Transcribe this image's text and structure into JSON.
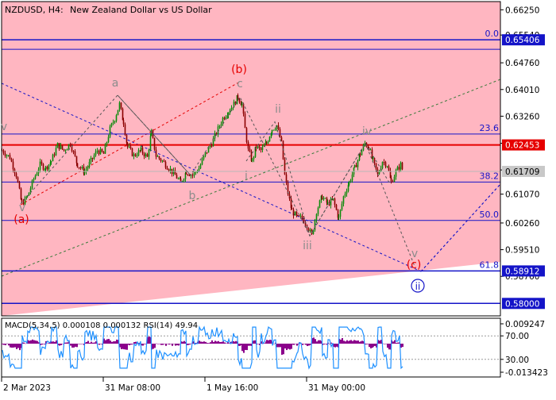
{
  "header": {
    "symbol": "NZDUSD, H4:",
    "description": "New Zealand Dollar vs US Dollar"
  },
  "colors": {
    "background_upper": "#ffb6c1",
    "background_lower": "#ffffff",
    "frame": "#000000",
    "fib_line": "#1414c8",
    "resistance_line": "#e60000",
    "price_label_bg": "#e60000",
    "support_label_bg": "#1414c8",
    "current_label_bg": "#c8c8c8",
    "candle_up": "#0a8a0a",
    "candle_down": "#8a0000",
    "wave_main": "#e60000",
    "wave_minor": "#8c8c8c",
    "wave_circle": "#1414c8",
    "channel_dotted": "#1414c8",
    "trend_dotted": "#3a7a3a",
    "macd_hist": "#8b008b",
    "rsi_line": "#1e90ff"
  },
  "price_axis": {
    "ticks": [
      "0.66250",
      "0.65540",
      "0.64760",
      "0.64010",
      "0.63260",
      "0.62500",
      "0.61750",
      "0.61070",
      "0.60260",
      "0.59510",
      "0.58760"
    ]
  },
  "price_labels": {
    "fib_0": "0.65406",
    "resistance": "0.62453",
    "current": "0.61709",
    "fib_61_8": "0.58912",
    "support": "0.58000"
  },
  "fib_levels": [
    "0.0",
    "23.6",
    "38.2",
    "50.0",
    "61.8"
  ],
  "wave_labels": {
    "main": [
      "(a)",
      "(b)",
      "(c)"
    ],
    "minor": [
      "a",
      "b",
      "c",
      "i",
      "ii",
      "iii",
      "iv",
      "v",
      "v",
      "v"
    ],
    "circled": "ii"
  },
  "indicator": {
    "label": "MACD(5,34,5) 0.000108 0.000132 RSI(14) 49.94",
    "axis_ticks": [
      "0.009247",
      "70.00",
      "30.00",
      "-0.013423"
    ]
  },
  "time_axis": {
    "ticks": [
      "2 Mar 2023",
      "31 Mar 08:00",
      "1 May 16:00",
      "31 May 00:00"
    ]
  },
  "chart_data": {
    "type": "candlestick",
    "title": "NZDUSD, H4: New Zealand Dollar vs US Dollar",
    "ylim": [
      0.5765,
      0.6648
    ],
    "x_ticks": [
      "2 Mar 2023",
      "31 Mar 08:00",
      "1 May 16:00",
      "31 May 00:00"
    ],
    "horizontal_levels": [
      {
        "label": "0.0",
        "price": 0.65406
      },
      {
        "label": "23.6",
        "price": 0.6276
      },
      {
        "label": "",
        "price": 0.62453
      },
      {
        "label": "38.2",
        "price": 0.6141
      },
      {
        "label": "50.0",
        "price": 0.6033
      },
      {
        "label": "61.8",
        "price": 0.58912
      },
      {
        "label": "",
        "price": 0.58
      }
    ],
    "price_path": [
      [
        0,
        0.623
      ],
      [
        10,
        0.621
      ],
      [
        18,
        0.616
      ],
      [
        25,
        0.608
      ],
      [
        32,
        0.61
      ],
      [
        40,
        0.615
      ],
      [
        48,
        0.619
      ],
      [
        55,
        0.618
      ],
      [
        62,
        0.62
      ],
      [
        70,
        0.6245
      ],
      [
        78,
        0.623
      ],
      [
        86,
        0.625
      ],
      [
        95,
        0.619
      ],
      [
        104,
        0.617
      ],
      [
        112,
        0.62
      ],
      [
        120,
        0.623
      ],
      [
        128,
        0.622
      ],
      [
        136,
        0.629
      ],
      [
        142,
        0.632
      ],
      [
        148,
        0.636
      ],
      [
        153,
        0.631
      ],
      [
        158,
        0.624
      ],
      [
        166,
        0.6215
      ],
      [
        175,
        0.623
      ],
      [
        183,
        0.621
      ],
      [
        188,
        0.628
      ],
      [
        194,
        0.6215
      ],
      [
        202,
        0.62
      ],
      [
        210,
        0.618
      ],
      [
        218,
        0.616
      ],
      [
        225,
        0.614
      ],
      [
        232,
        0.617
      ],
      [
        240,
        0.616
      ],
      [
        248,
        0.618
      ],
      [
        256,
        0.622
      ],
      [
        264,
        0.625
      ],
      [
        270,
        0.628
      ],
      [
        278,
        0.632
      ],
      [
        285,
        0.634
      ],
      [
        292,
        0.636
      ],
      [
        297,
        0.638
      ],
      [
        302,
        0.636
      ],
      [
        306,
        0.629
      ],
      [
        310,
        0.623
      ],
      [
        315,
        0.62
      ],
      [
        320,
        0.624
      ],
      [
        326,
        0.623
      ],
      [
        333,
        0.625
      ],
      [
        340,
        0.629
      ],
      [
        346,
        0.63
      ],
      [
        352,
        0.625
      ],
      [
        356,
        0.616
      ],
      [
        360,
        0.611
      ],
      [
        365,
        0.606
      ],
      [
        372,
        0.604
      ],
      [
        378,
        0.604
      ],
      [
        384,
        0.602
      ],
      [
        390,
        0.599
      ],
      [
        396,
        0.606
      ],
      [
        403,
        0.61
      ],
      [
        410,
        0.608
      ],
      [
        417,
        0.609
      ],
      [
        424,
        0.604
      ],
      [
        430,
        0.61
      ],
      [
        437,
        0.614
      ],
      [
        444,
        0.618
      ],
      [
        451,
        0.622
      ],
      [
        457,
        0.625
      ],
      [
        462,
        0.624
      ],
      [
        467,
        0.62
      ],
      [
        473,
        0.616
      ],
      [
        479,
        0.62
      ],
      [
        485,
        0.619
      ],
      [
        490,
        0.614
      ],
      [
        496,
        0.617
      ],
      [
        502,
        0.619
      ],
      [
        505,
        0.6171
      ]
    ],
    "wave_points": [
      {
        "label": "(a)",
        "price": 0.6075
      },
      {
        "label": "(b)",
        "price": 0.6412
      },
      {
        "label": "(c)",
        "price": 0.5885
      },
      {
        "label": "a",
        "price": 0.6395
      },
      {
        "label": "b",
        "price": 0.616
      },
      {
        "label": "c",
        "price": 0.6395
      },
      {
        "label": "i",
        "price": 0.6155
      },
      {
        "label": "ii",
        "price": 0.6317
      },
      {
        "label": "iii",
        "price": 0.5985
      },
      {
        "label": "iv",
        "price": 0.6265
      },
      {
        "label": "v",
        "price": 0.592
      }
    ]
  }
}
